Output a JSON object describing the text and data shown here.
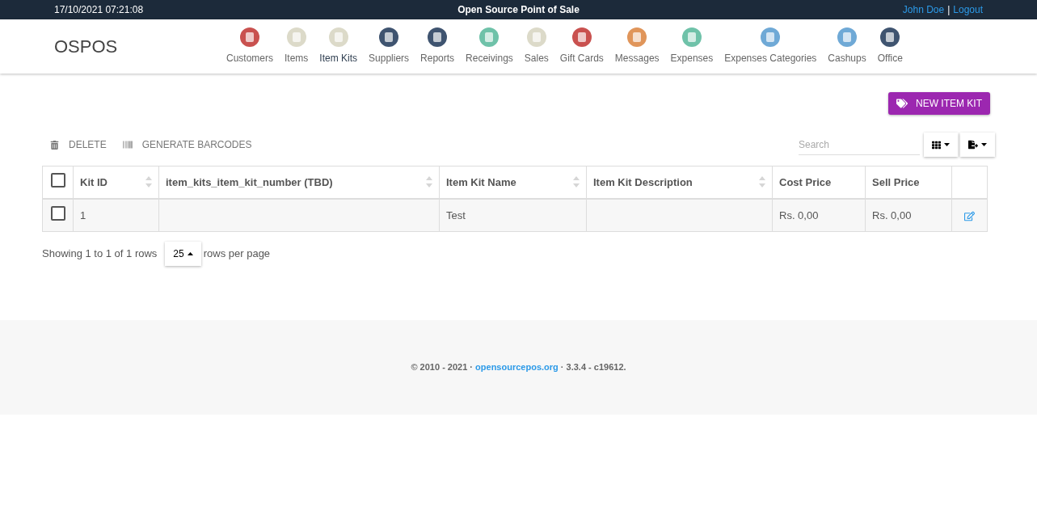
{
  "top_bar": {
    "datetime": "17/10/2021 07:21:08",
    "title": "Open Source Point of Sale",
    "user": "John Doe",
    "separator": "|",
    "logout": "Logout"
  },
  "brand": "OSPOS",
  "nav": [
    {
      "label": "Customers",
      "color": "#c9514f",
      "selected": false
    },
    {
      "label": "Items",
      "color": "#dcdac9",
      "selected": false
    },
    {
      "label": "Item Kits",
      "color": "#dcdac9",
      "selected": true
    },
    {
      "label": "Suppliers",
      "color": "#3f5470",
      "selected": false
    },
    {
      "label": "Reports",
      "color": "#3f5470",
      "selected": false
    },
    {
      "label": "Receivings",
      "color": "#6fc2a9",
      "selected": false
    },
    {
      "label": "Sales",
      "color": "#dcdac9",
      "selected": false
    },
    {
      "label": "Gift Cards",
      "color": "#c9514f",
      "selected": false
    },
    {
      "label": "Messages",
      "color": "#e0955a",
      "selected": false
    },
    {
      "label": "Expenses",
      "color": "#6fc2a9",
      "selected": false
    },
    {
      "label": "Expenses Categories",
      "color": "#6fa9d6",
      "selected": false
    },
    {
      "label": "Cashups",
      "color": "#6fa9d6",
      "selected": false
    },
    {
      "label": "Office",
      "color": "#3f5470",
      "selected": false
    }
  ],
  "new_button": "NEW ITEM KIT",
  "toolbar": {
    "delete": "DELETE",
    "barcodes": "GENERATE BARCODES",
    "search": {
      "placeholder": "Search"
    }
  },
  "table": {
    "header_checked": false,
    "columns": [
      {
        "label": "Kit ID",
        "sortable": true
      },
      {
        "label": "item_kits_item_kit_number (TBD)",
        "sortable": true
      },
      {
        "label": "Item Kit Name",
        "sortable": true
      },
      {
        "label": "Item Kit Description",
        "sortable": true
      },
      {
        "label": "Cost Price",
        "sortable": false
      },
      {
        "label": "Sell Price",
        "sortable": false
      }
    ],
    "rows": [
      {
        "checked": false,
        "cells": [
          "1",
          "",
          "Test",
          "",
          "Rs. 0,00",
          "Rs. 0,00"
        ]
      }
    ]
  },
  "pagination": {
    "showing": "Showing 1 to 1 of 1 rows",
    "page_size": "25",
    "suffix": "rows per page"
  },
  "footer": {
    "before": "© 2010 - 2021 · ",
    "link": "opensourcepos.org",
    "after": " · 3.3.4 - c19612."
  }
}
